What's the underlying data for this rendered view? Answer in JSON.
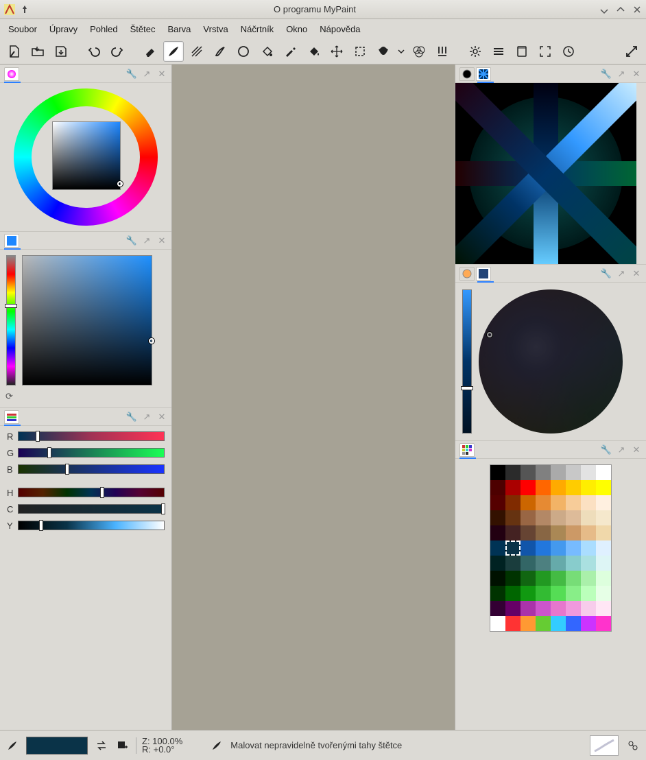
{
  "titlebar": {
    "title": "O programu MyPaint"
  },
  "menu": [
    "Soubor",
    "Úpravy",
    "Pohled",
    "Štětec",
    "Barva",
    "Vrstva",
    "Náčrtník",
    "Okno",
    "Nápověda"
  ],
  "sliders": {
    "r": {
      "label": "R",
      "pct": 12
    },
    "g": {
      "label": "G",
      "pct": 20
    },
    "b": {
      "label": "B",
      "pct": 32
    },
    "h": {
      "label": "H",
      "pct": 56
    },
    "c": {
      "label": "C",
      "pct": 98
    },
    "y": {
      "label": "Y",
      "pct": 14
    }
  },
  "status": {
    "zoom": "Z: 100.0%",
    "rot": "R: +0.0°",
    "mode": "Malovat nepravidelně tvořenými tahy štětce",
    "swatch": "#0a3348"
  },
  "palette": [
    "#000000",
    "#2b2b2b",
    "#555555",
    "#808080",
    "#aaaaaa",
    "#c8c8c8",
    "#e3e3e3",
    "#ffffff",
    "#4d0000",
    "#aa0000",
    "#ff0000",
    "#ff6600",
    "#ffaa00",
    "#ffcc00",
    "#ffee00",
    "#ffff00",
    "#550000",
    "#802b00",
    "#cc6600",
    "#e68a33",
    "#f2b366",
    "#f7cc99",
    "#fbe0c2",
    "#fff0e0",
    "#331100",
    "#663311",
    "#996644",
    "#b38866",
    "#ccaa88",
    "#ddbb99",
    "#eeddbb",
    "#f5e8cc",
    "#220011",
    "#442222",
    "#664433",
    "#886644",
    "#aa8855",
    "#cc9966",
    "#e6bb88",
    "#f0d8aa",
    "#003355",
    "#0a3348",
    "#1155aa",
    "#2277dd",
    "#4499ee",
    "#77bbff",
    "#aaddff",
    "#dff0ff",
    "#002222",
    "#1a3d3d",
    "#336666",
    "#4d8080",
    "#66aaaa",
    "#88cccc",
    "#aae0e0",
    "#ddf5f5",
    "#001100",
    "#003300",
    "#116611",
    "#229922",
    "#44bb44",
    "#77dd77",
    "#aaf0aa",
    "#ddffdd",
    "#003300",
    "#006600",
    "#119911",
    "#33bb33",
    "#55dd55",
    "#88ee88",
    "#bbffbb",
    "#e6ffe6",
    "#330033",
    "#660066",
    "#aa33aa",
    "#cc55cc",
    "#e677cc",
    "#f099dd",
    "#f7cceb",
    "#ffe6f5",
    "#ffffff",
    "#ff3333",
    "#ff9933",
    "#66cc33",
    "#33ccff",
    "#3366ff",
    "#cc33ff",
    "#ff33cc"
  ],
  "selected_palette_index": 41
}
